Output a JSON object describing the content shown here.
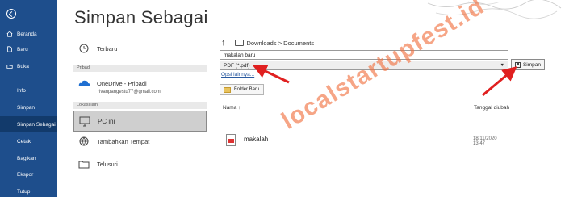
{
  "rail": {
    "items": [
      {
        "label": "Beranda",
        "icon": "home-icon"
      },
      {
        "label": "Baru",
        "icon": "new-document-icon"
      },
      {
        "label": "Buka",
        "icon": "open-folder-icon"
      },
      {
        "label": "Info"
      },
      {
        "label": "Simpan"
      },
      {
        "label": "Simpan Sebagai",
        "selected": true
      },
      {
        "label": "Cetak"
      },
      {
        "label": "Bagikan"
      },
      {
        "label": "Ekspor"
      },
      {
        "label": "Tutup"
      }
    ]
  },
  "title": "Simpan Sebagai",
  "locations": {
    "recent": "Terbaru",
    "personal_section": "Pribadi",
    "onedrive": "OneDrive - Pribadi",
    "onedrive_email": "rivanpangestu77@gmail.com",
    "other_section": "Lokasi lain",
    "this_pc": "PC ini",
    "add_place": "Tambahkan Tempat",
    "browse": "Telusuri"
  },
  "save_panel": {
    "breadcrumb": "Downloads > Documents",
    "filename_value": "makalah baru",
    "filetype_value": "PDF (*.pdf)",
    "save_label": "Simpan",
    "more_options": "Opsi lainnya...",
    "new_folder": "Folder Baru",
    "col_name": "Nama ↑",
    "col_date": "Tanggal diubah",
    "file_name": "makalah",
    "file_date": "18/11/2020 13:47"
  },
  "watermark": "localstartupfest.id",
  "colors": {
    "rail": "#1e4e8c",
    "rail_selected": "#123a6b",
    "arrow": "#e02020",
    "link": "#2a5aa0"
  }
}
